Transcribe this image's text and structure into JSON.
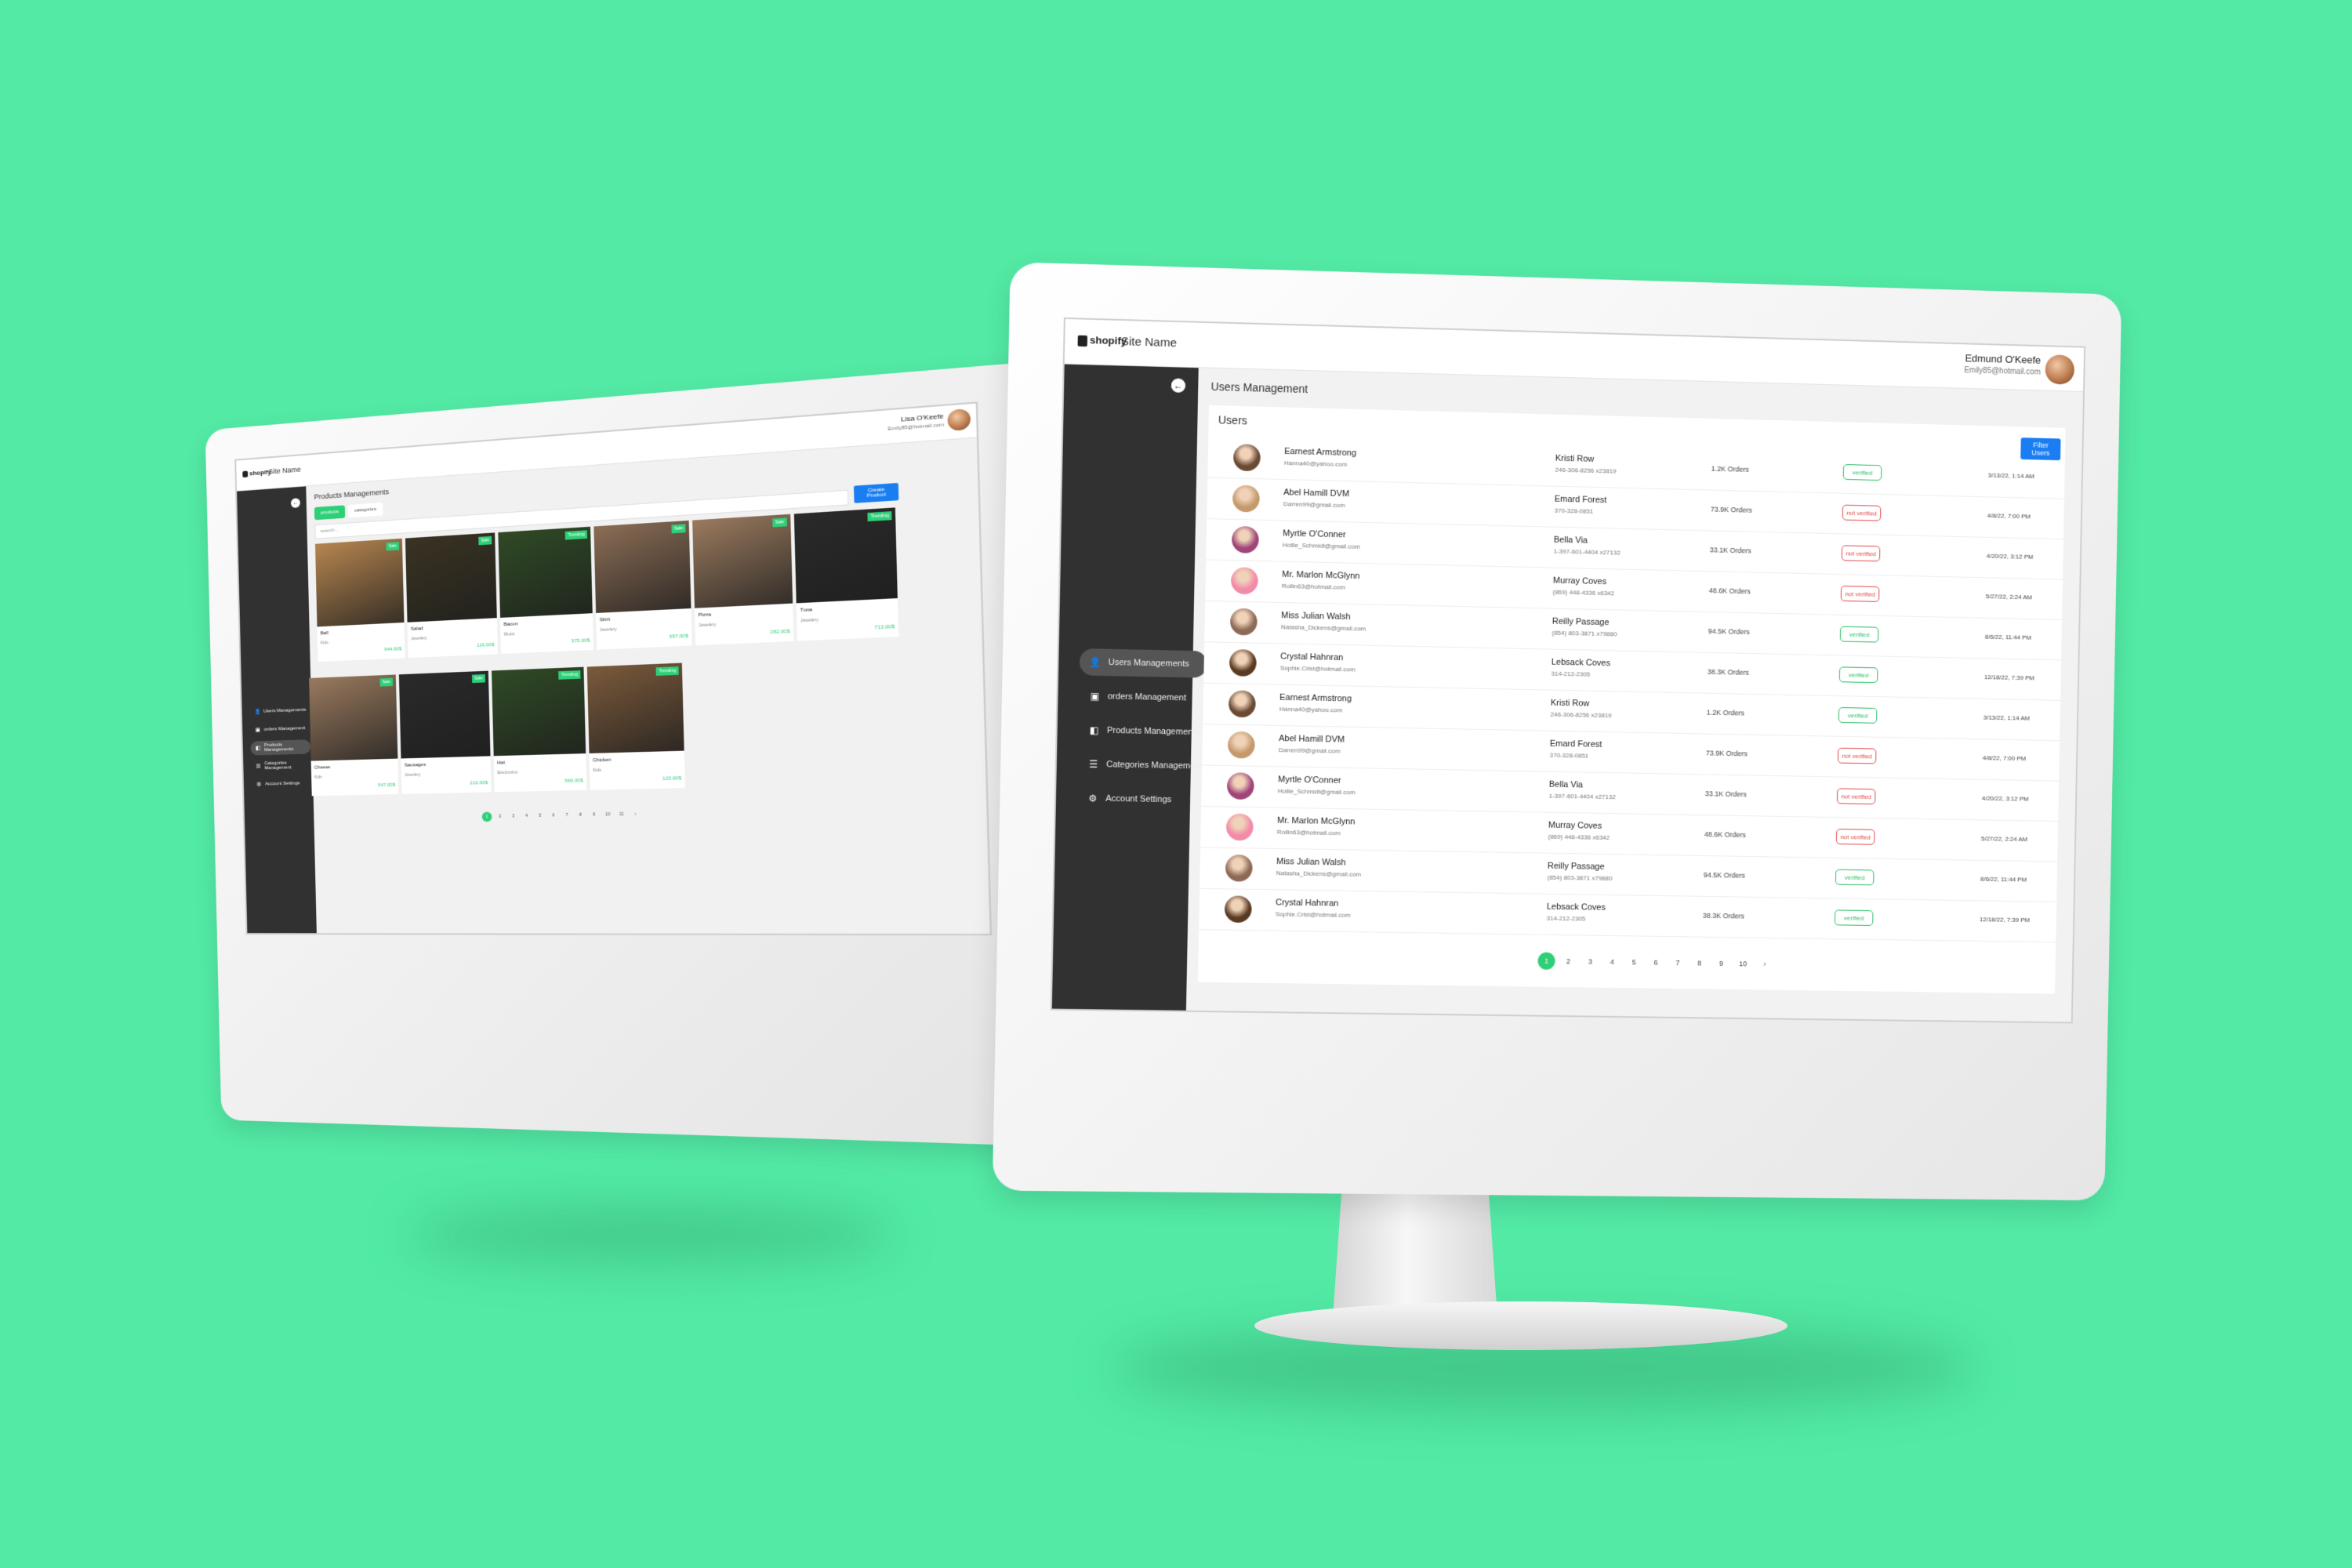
{
  "colors": {
    "background": "#52eaa5",
    "accent_green": "#2fcf78",
    "primary_blue": "#1a7ef2",
    "sidebar": "#313131",
    "verified": "#2bbf63",
    "not_verified": "#e24b4b"
  },
  "monitor_b": {
    "header": {
      "logo": "shopify",
      "site_name": "Site Name",
      "user_name": "Edmund O'Keefe",
      "user_email": "Emily85@hotmail.com"
    },
    "sidebar": {
      "collapse_icon": "arrow-left-icon",
      "items": [
        {
          "label": "Users Managements",
          "icon": "user-icon",
          "active": true
        },
        {
          "label": "orders Management",
          "icon": "box-icon",
          "active": false
        },
        {
          "label": "Products Managements",
          "icon": "tag-icon",
          "active": false
        },
        {
          "label": "Categories Management",
          "icon": "list-icon",
          "active": false
        },
        {
          "label": "Account Settings",
          "icon": "gears-icon",
          "active": false
        }
      ]
    },
    "page_title": "Users Management",
    "card_title": "Users",
    "filter_button": "Filter Users",
    "users": [
      {
        "name": "Earnest Armstrong",
        "email": "Hanna40@yahoo.com",
        "address": "Kristi Row",
        "phone": "246-306-8256 x23819",
        "orders": "1.2K Orders",
        "status": "verified",
        "verified": true,
        "date": "3/13/22, 1:14 AM",
        "avatar": "#6b4a33"
      },
      {
        "name": "Abel Hamill DVM",
        "email": "Darren99@gmail.com",
        "address": "Emard Forest",
        "phone": "370-328-0851",
        "orders": "73.9K Orders",
        "status": "not verified",
        "verified": false,
        "date": "4/8/22, 7:00 PM",
        "avatar": "#c49a6c"
      },
      {
        "name": "Myrtle O'Conner",
        "email": "Hollie_Schmidt@gmail.com",
        "address": "Bella Via",
        "phone": "1-397-601-4404 x27132",
        "orders": "33.1K Orders",
        "status": "not verified",
        "verified": false,
        "date": "4/20/22, 3:12 PM",
        "avatar": "#a0457a"
      },
      {
        "name": "Mr. Marlon McGlynn",
        "email": "Rollin63@hotmail.com",
        "address": "Murray Coves",
        "phone": "(869) 448-4336 x6342",
        "orders": "48.6K Orders",
        "status": "not verified",
        "verified": false,
        "date": "5/27/22, 2:24 AM",
        "avatar": "#f28aa8"
      },
      {
        "name": "Miss Julian Walsh",
        "email": "Natasha_Dickens@gmail.com",
        "address": "Reilly Passage",
        "phone": "(854) 803-3871 x79880",
        "orders": "94.5K Orders",
        "status": "verified",
        "verified": true,
        "date": "8/6/22, 11:44 PM",
        "avatar": "#8c6a56"
      },
      {
        "name": "Crystal Hahnran",
        "email": "Sophie.Crist@hotmail.com",
        "address": "Lebsack Coves",
        "phone": "314-212-2305",
        "orders": "38.3K Orders",
        "status": "verified",
        "verified": true,
        "date": "12/18/22, 7:39 PM",
        "avatar": "#5a3a22"
      },
      {
        "name": "Earnest Armstrong",
        "email": "Hanna40@yahoo.com",
        "address": "Kristi Row",
        "phone": "246-306-8256 x23819",
        "orders": "1.2K Orders",
        "status": "verified",
        "verified": true,
        "date": "3/13/22, 1:14 AM",
        "avatar": "#6b4a33"
      },
      {
        "name": "Abel Hamill DVM",
        "email": "Darren99@gmail.com",
        "address": "Emard Forest",
        "phone": "370-328-0851",
        "orders": "73.9K Orders",
        "status": "not verified",
        "verified": false,
        "date": "4/8/22, 7:00 PM",
        "avatar": "#c49a6c"
      },
      {
        "name": "Myrtle O'Conner",
        "email": "Hollie_Schmidt@gmail.com",
        "address": "Bella Via",
        "phone": "1-397-601-4404 x27132",
        "orders": "33.1K Orders",
        "status": "not verified",
        "verified": false,
        "date": "4/20/22, 3:12 PM",
        "avatar": "#a0457a"
      },
      {
        "name": "Mr. Marlon McGlynn",
        "email": "Rollin63@hotmail.com",
        "address": "Murray Coves",
        "phone": "(869) 448-4336 x6342",
        "orders": "48.6K Orders",
        "status": "not verified",
        "verified": false,
        "date": "5/27/22, 2:24 AM",
        "avatar": "#f28aa8"
      },
      {
        "name": "Miss Julian Walsh",
        "email": "Natasha_Dickens@gmail.com",
        "address": "Reilly Passage",
        "phone": "(854) 803-3871 x79880",
        "orders": "94.5K Orders",
        "status": "verified",
        "verified": true,
        "date": "8/6/22, 11:44 PM",
        "avatar": "#8c6a56"
      },
      {
        "name": "Crystal Hahnran",
        "email": "Sophie.Crist@hotmail.com",
        "address": "Lebsack Coves",
        "phone": "314-212-2305",
        "orders": "38.3K Orders",
        "status": "verified",
        "verified": true,
        "date": "12/18/22, 7:39 PM",
        "avatar": "#5a3a22"
      }
    ],
    "pagination": {
      "pages": [
        "1",
        "2",
        "3",
        "4",
        "5",
        "6",
        "7",
        "8",
        "9",
        "10"
      ],
      "current": "1",
      "next_icon": "chevron-right-icon"
    }
  },
  "monitor_a": {
    "header": {
      "logo": "shopify",
      "site_name": "Site Name",
      "user_name": "Lisa O'Keefe",
      "user_email": "Emily85@hotmail.com"
    },
    "sidebar": {
      "collapse_icon": "arrow-left-icon",
      "items": [
        {
          "label": "Users Managements",
          "icon": "user-icon",
          "active": false
        },
        {
          "label": "orders Management",
          "icon": "box-icon",
          "active": false
        },
        {
          "label": "Products Managements",
          "icon": "tag-icon",
          "active": true
        },
        {
          "label": "Categories Management",
          "icon": "list-icon",
          "active": false
        },
        {
          "label": "Account Settings",
          "icon": "gears-icon",
          "active": false
        }
      ]
    },
    "page_title": "Products Managements",
    "tabs": [
      {
        "label": "products",
        "active": true
      },
      {
        "label": "categories",
        "active": false
      }
    ],
    "search_placeholder": "search...",
    "create_button": "Create Product",
    "products": [
      {
        "name": "Ball",
        "category": "Kids",
        "price": "944.00$",
        "tag": "Sale",
        "img": "#b6854f"
      },
      {
        "name": "Salad",
        "category": "Jewelery",
        "price": "119.00$",
        "tag": "Sale",
        "img": "#3a3322"
      },
      {
        "name": "Bacon",
        "category": "Music",
        "price": "375.00$",
        "tag": "Trending",
        "img": "#2f4a25"
      },
      {
        "name": "Shirt",
        "category": "Jewelery",
        "price": "557.00$",
        "tag": "Sale",
        "img": "#8b6d55"
      },
      {
        "name": "Pizza",
        "category": "Jewelery",
        "price": "282.00$",
        "tag": "Sale",
        "img": "#9a7a5e"
      },
      {
        "name": "Tuna",
        "category": "Jewelery",
        "price": "713.00$",
        "tag": "Trending",
        "img": "#2a2a2a"
      },
      {
        "name": "Cheese",
        "category": "Kids",
        "price": "547.00$",
        "tag": "Sale",
        "img": "#9a7a5e"
      },
      {
        "name": "Sausages",
        "category": "Jewelery",
        "price": "210.00$",
        "tag": "Sale",
        "img": "#2a2a2a"
      },
      {
        "name": "Hat",
        "category": "Electronics",
        "price": "569.00$",
        "tag": "Trending",
        "img": "#2f4a25"
      },
      {
        "name": "Chicken",
        "category": "Kids",
        "price": "123.00$",
        "tag": "Trending",
        "img": "#7b5a3b"
      }
    ],
    "pagination": {
      "pages": [
        "1",
        "2",
        "3",
        "4",
        "5",
        "6",
        "7",
        "8",
        "9",
        "10",
        "11"
      ],
      "current": "1",
      "next_icon": "chevron-right-icon"
    }
  }
}
